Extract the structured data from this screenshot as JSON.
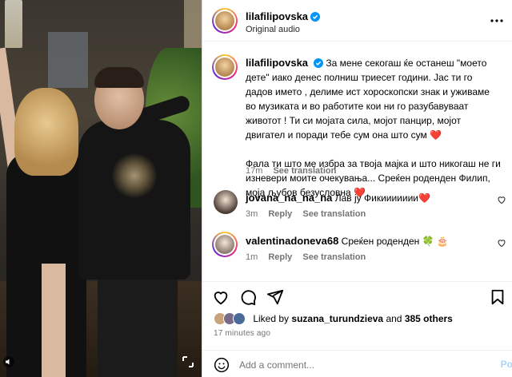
{
  "post": {
    "username": "lilafilipovska",
    "audio_label": "Original audio"
  },
  "caption": {
    "username": "lilafilipovska",
    "paragraph1": "За мене секогаш ќе останеш \"моето дете\" иако денес полниш триесет години. Јас ти го дадов името , делиме ист хороскопски знак и уживаме во музиката и во работите кои ни го разубавуваат животот ! Ти си мојата сила, мојот панцир, мојот двигател и поради тебе сум она што сум",
    "paragraph2": "Фала ти што ме избра за твоја мајка и што никогаш не ги изневери моите очекувања... Среќен роденден Филип, моја љубов безусловна",
    "heart": "❤️",
    "time": "17m",
    "see_translation": "See translation"
  },
  "comments": [
    {
      "username": "jovana_na_na_na",
      "text": "Лав ју Фикиииииии",
      "emoji": "❤️",
      "time": "3m",
      "reply": "Reply",
      "see_translation": "See translation"
    },
    {
      "username": "valentinadoneva68",
      "text": "Среќен роденден",
      "emoji": "🍀 🎂",
      "time": "1m",
      "reply": "Reply",
      "see_translation": "See translation"
    }
  ],
  "likes": {
    "prefix": "Liked by",
    "by": "suzana_turundzieva",
    "connector": "and",
    "others": "385 others"
  },
  "time_ago": "17 minutes ago",
  "add_comment": {
    "placeholder": "Add a comment...",
    "post_label": "Po"
  },
  "colors": {
    "accent_link": "#a8d4fb",
    "heart": "#ed1c24",
    "verified": "#0095f6",
    "muted": "#737373"
  },
  "icons": [
    "audio-muted-icon",
    "expand-icon",
    "verified-icon",
    "more-options-icon",
    "like-icon",
    "comment-icon",
    "share-icon",
    "save-icon",
    "emoji-icon"
  ]
}
